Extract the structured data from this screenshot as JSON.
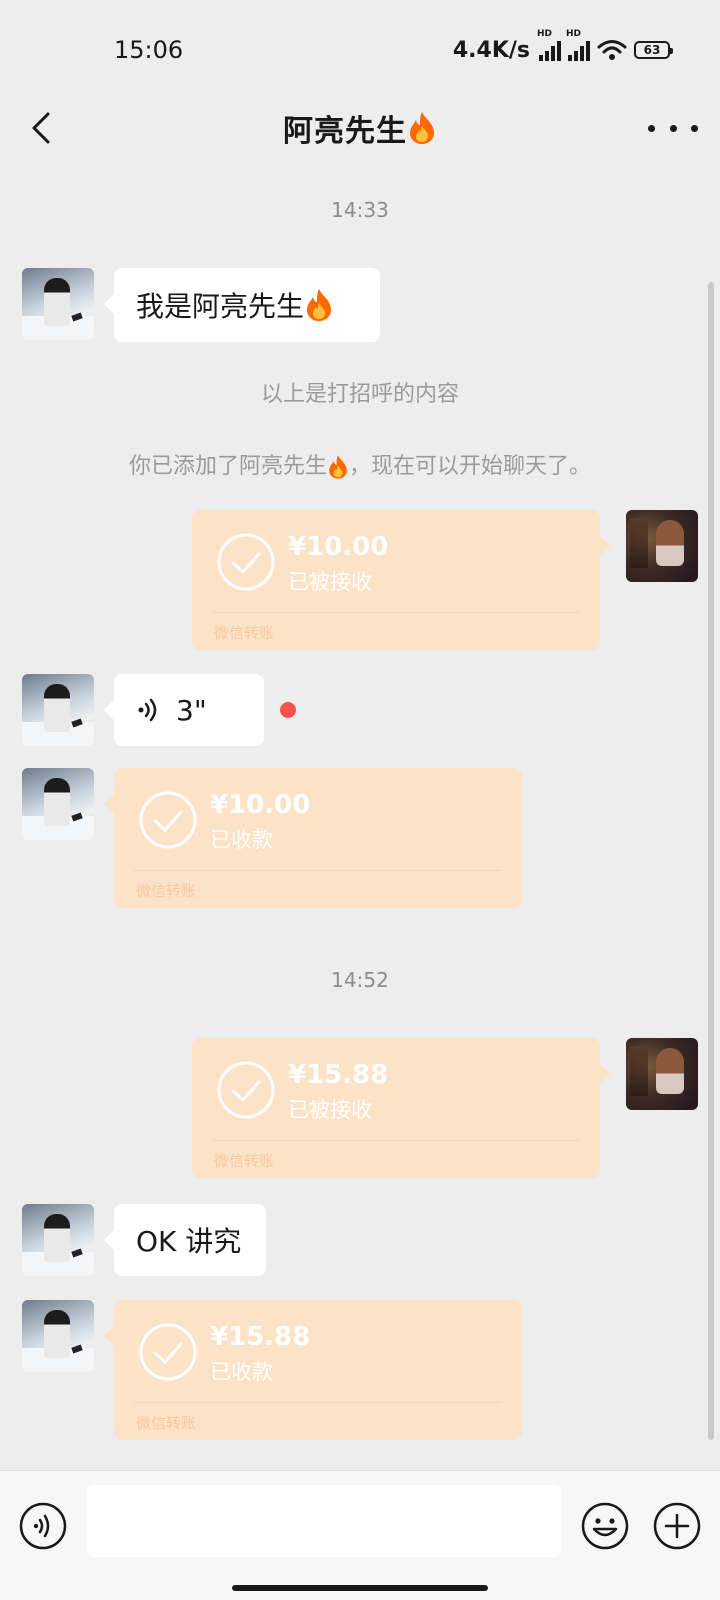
{
  "status_bar": {
    "time": "15:06",
    "net_speed": "4.4K/s",
    "signal_badge_1": "HD",
    "signal_badge_2": "HD",
    "battery": "63"
  },
  "header": {
    "title": "阿亮先生",
    "title_icon": "fire-icon",
    "back_icon": "back-arrow-icon",
    "more_icon": "more-dots-icon"
  },
  "messages": {
    "time_1": "14:33",
    "greeting": "我是阿亮先生",
    "greeting_note": "以上是打招呼的内容",
    "added_note_prefix": "你已添加了阿亮先生",
    "added_note_suffix": "，现在可以开始聊天了。",
    "transfer_1": {
      "amount": "¥10.00",
      "status": "已被接收",
      "label": "微信转账"
    },
    "voice": {
      "duration": "3\""
    },
    "transfer_2": {
      "amount": "¥10.00",
      "status": "已收款",
      "label": "微信转账"
    },
    "time_2": "14:52",
    "transfer_3": {
      "amount": "¥15.88",
      "status": "已被接收",
      "label": "微信转账"
    },
    "reply": "OK 讲究",
    "transfer_4": {
      "amount": "¥15.88",
      "status": "已收款",
      "label": "微信转账"
    }
  },
  "input_bar": {
    "voice_icon": "voice-toggle-icon",
    "input_value": "",
    "emoji_icon": "emoji-icon",
    "plus_icon": "plus-icon"
  },
  "colors": {
    "background": "#ededed",
    "bubble": "#ffffff",
    "transfer": "#fce2c7",
    "unread": "#fa5151"
  }
}
